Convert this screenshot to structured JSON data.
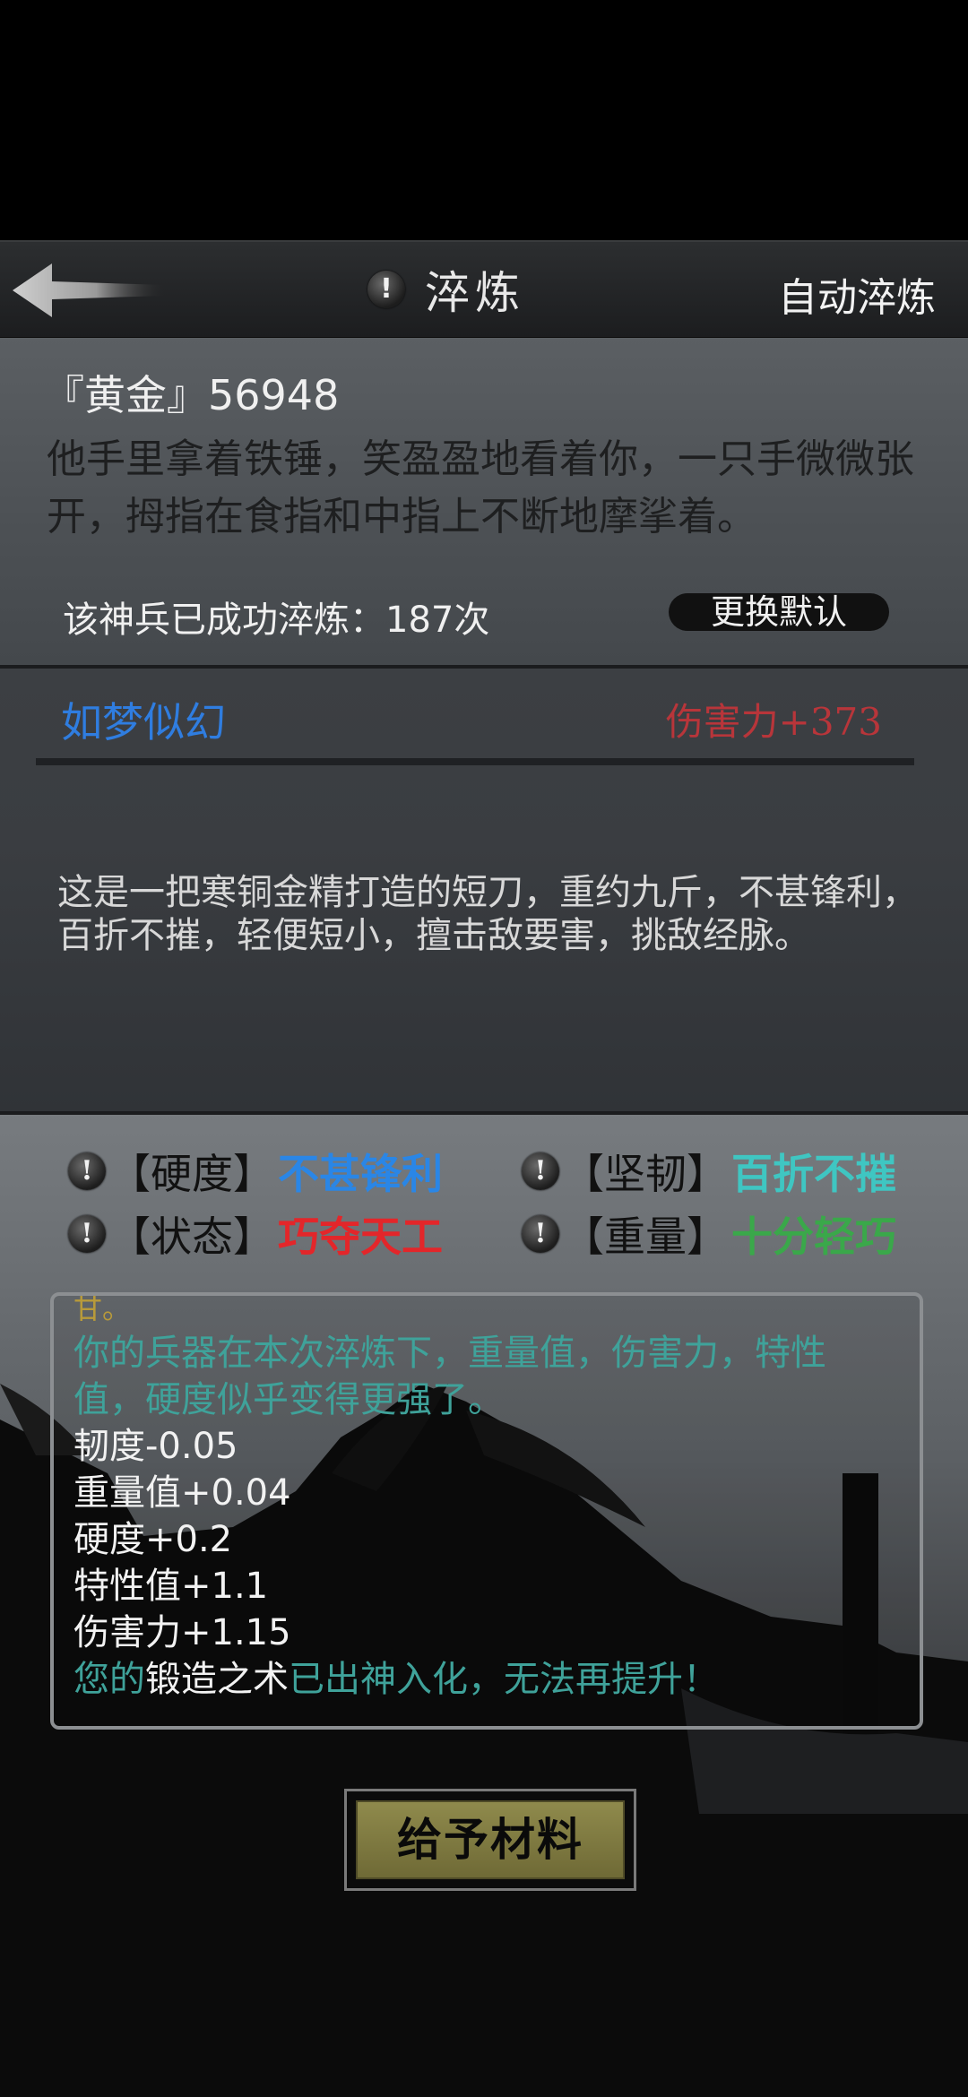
{
  "header": {
    "title": "淬炼",
    "auto_refine_label": "自动淬炼"
  },
  "info": {
    "item_name": "『黄金』56948",
    "description": "他手里拿着铁锤，笑盈盈地看着你，一只手微微张开，拇指在食指和中指上不断地摩挲着。",
    "refine_count": "该神兵已成功淬炼：187次",
    "change_default_label": "更换默认"
  },
  "weapon": {
    "skill_name": "如梦似幻",
    "damage_bonus": "伤害力+373",
    "description": "这是一把寒铜金精打造的短刀，重约九斤，不甚锋利，百折不摧，轻便短小，擅击敌要害，挑敌经脉。"
  },
  "attributes": [
    {
      "label": "【硬度】",
      "value": "不甚锋利",
      "color": "#2a86e6"
    },
    {
      "label": "【坚韧】",
      "value": "百折不摧",
      "color": "#3fc6c2"
    },
    {
      "label": "【状态】",
      "value": "巧夺天工",
      "color": "#e3262a"
    },
    {
      "label": "【重量】",
      "value": "十分轻巧",
      "color": "#3aa84a"
    }
  ],
  "log": {
    "cutoff": "甘。",
    "summary": [
      "你的兵器在本次淬炼下，重量值，伤害力，特性",
      "值，硬度似乎变得更强了。"
    ],
    "changes": [
      "韧度-0.05",
      "重量值+0.04",
      "硬度+0.2",
      "特性值+1.1",
      "伤害力+1.15"
    ],
    "final_a": "您的",
    "final_b": "锻造之术",
    "final_c": "已出神入化，无法再提升！"
  },
  "actions": {
    "give_material_label": "给予材料"
  },
  "colors": {
    "accent_teal": "#3fa29a",
    "skill_blue": "#2f7de0",
    "damage_red": "#b8353a",
    "button_olive": "#7f7a40"
  }
}
